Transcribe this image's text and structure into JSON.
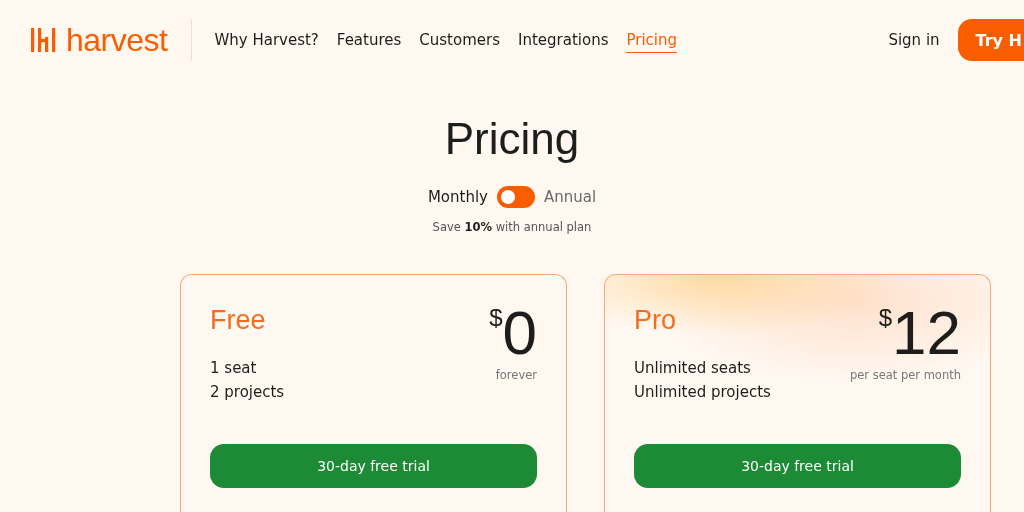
{
  "header": {
    "logo": "harvest",
    "nav": [
      {
        "label": "Why Harvest?",
        "selected": false
      },
      {
        "label": "Features",
        "selected": false
      },
      {
        "label": "Customers",
        "selected": false
      },
      {
        "label": "Integrations",
        "selected": false
      },
      {
        "label": "Pricing",
        "selected": true
      }
    ],
    "sign_in": "Sign in",
    "cta": "Try H"
  },
  "title": "Pricing",
  "billing": {
    "options": [
      {
        "label": "Monthly",
        "selected": true
      },
      {
        "label": "Annual",
        "selected": false
      }
    ],
    "note": "Save **10%** with annual plan"
  },
  "plans": [
    {
      "name": "Free",
      "currency": "$",
      "price": "0",
      "period": "forever",
      "features": [
        "1 seat",
        "2 projects"
      ],
      "button": "30-day free trial",
      "featured": false
    },
    {
      "name": "Pro",
      "currency": "$",
      "price": "12",
      "period": "per seat per month",
      "features": [
        "Unlimited seats",
        "Unlimited projects"
      ],
      "button": "30-day free trial",
      "featured": true
    }
  ]
}
